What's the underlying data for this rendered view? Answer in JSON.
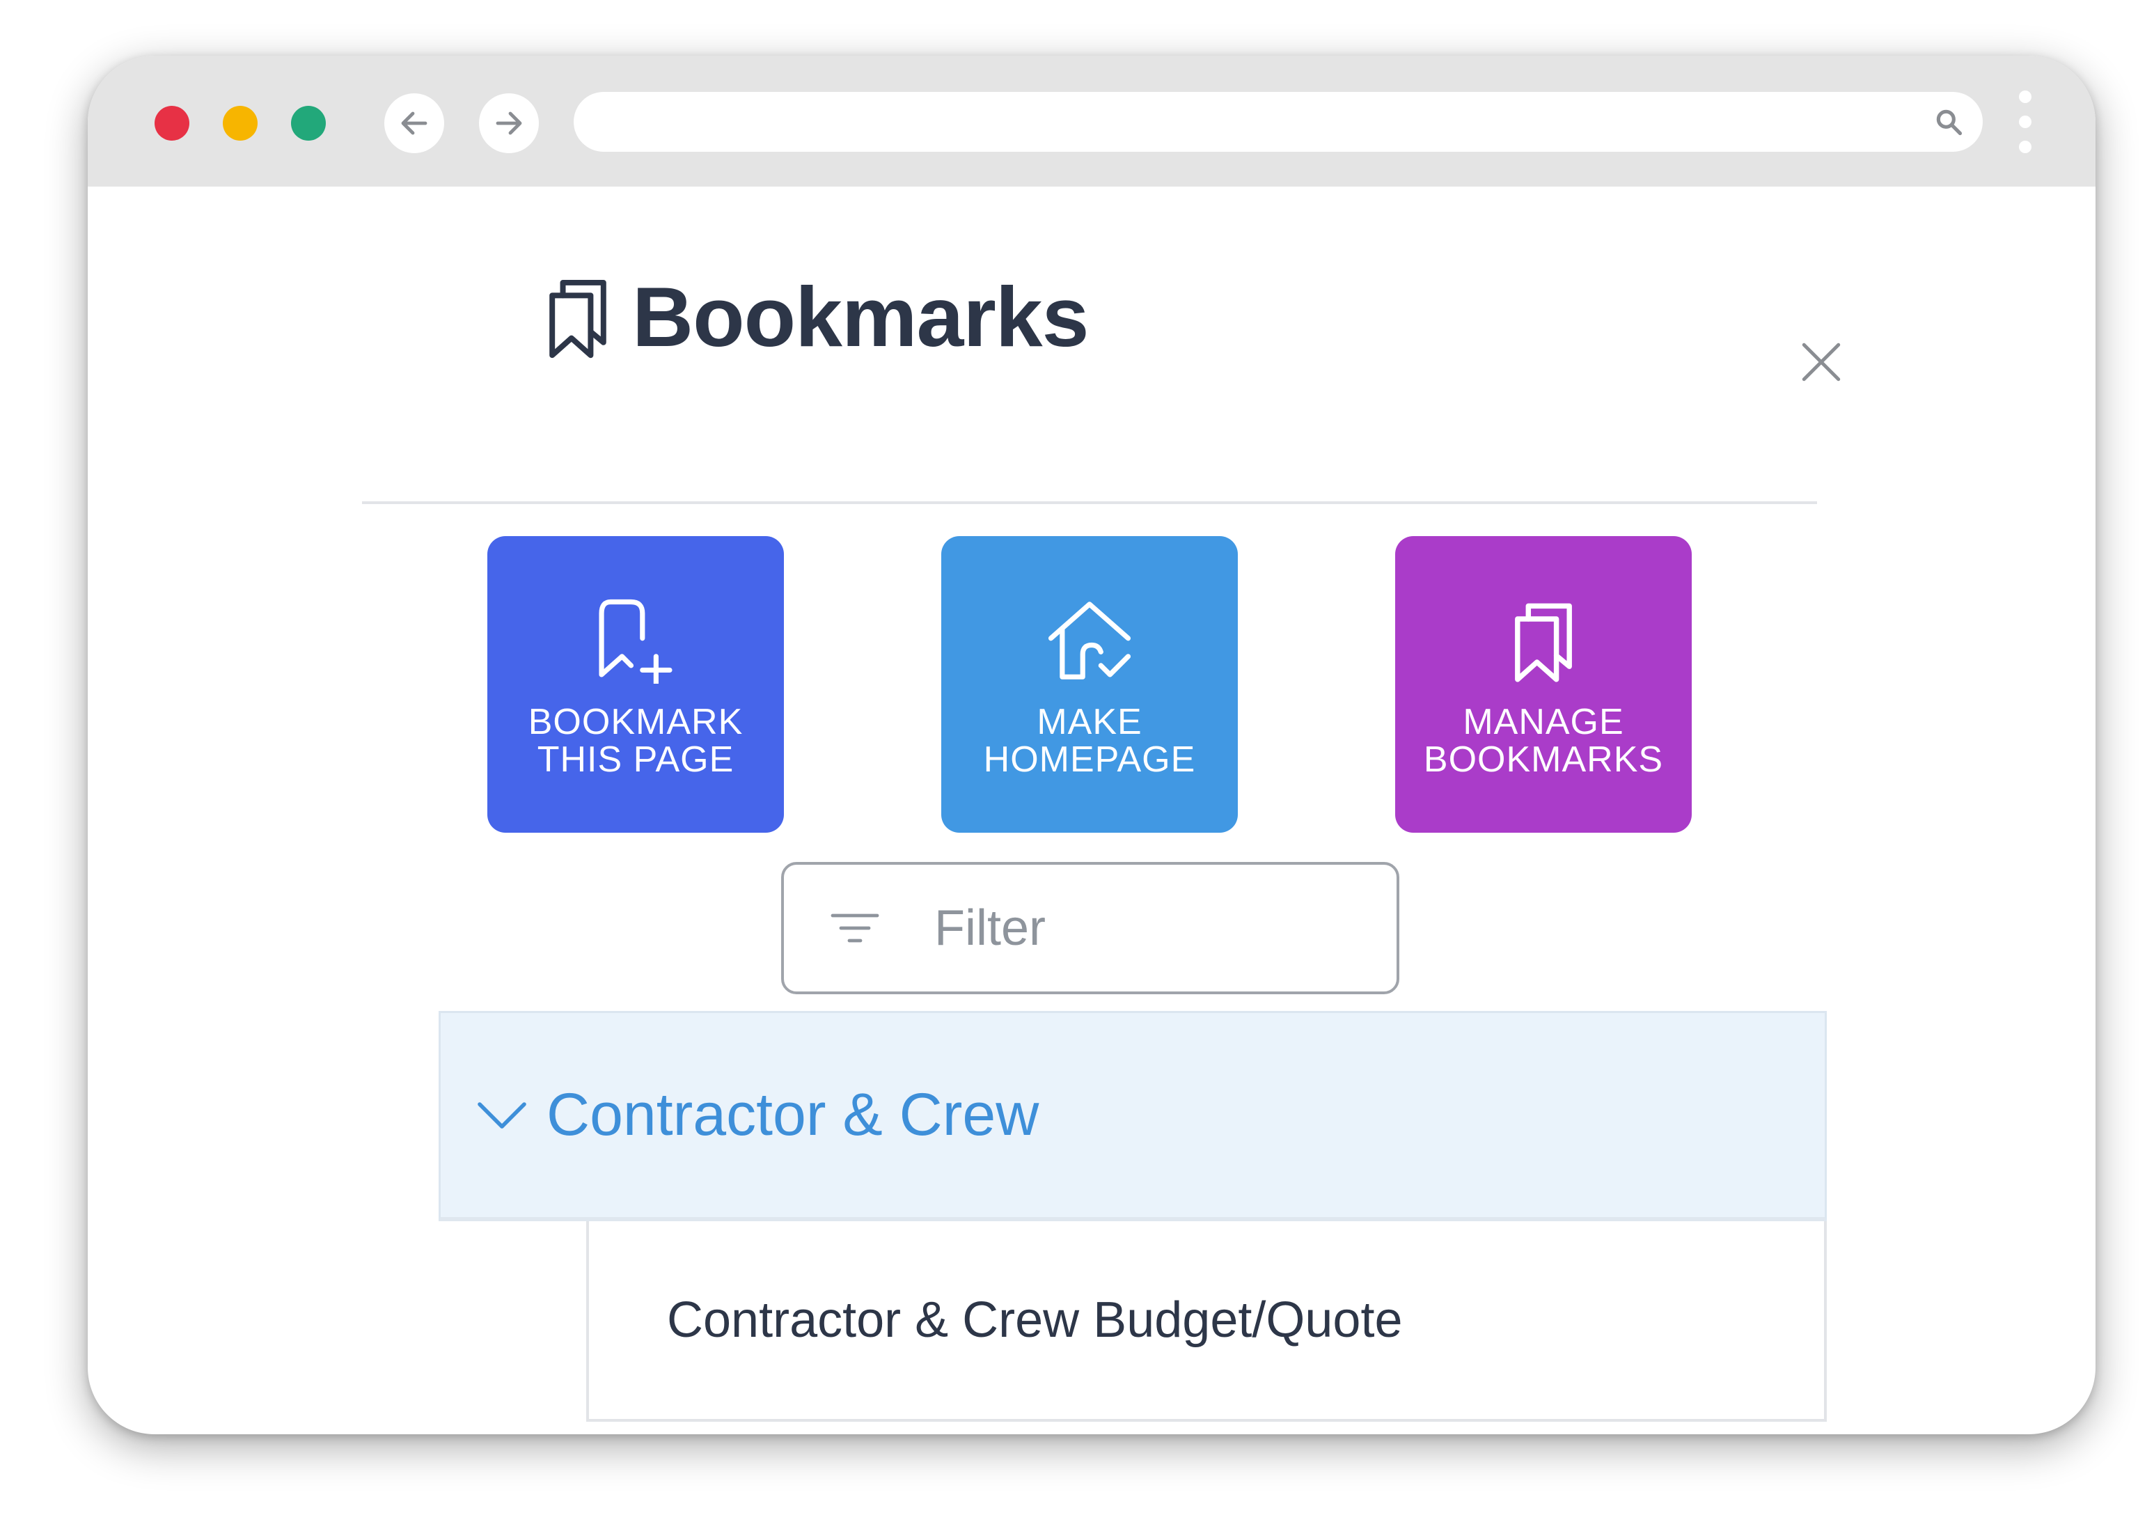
{
  "browser": {
    "icons": {
      "back": "arrow-left-icon",
      "forward": "arrow-right-icon",
      "search": "search-icon",
      "menu": "more-vertical-icon"
    },
    "colors": {
      "close": "#e73145",
      "minimize": "#f7b500",
      "maximize": "#22a87a"
    }
  },
  "panel": {
    "title": "Bookmarks",
    "title_icon": "bookmarks-icon",
    "close_icon": "close-icon",
    "actions": [
      {
        "label": "Bookmark this page",
        "icon": "bookmark-add-icon",
        "color": "#4665ea"
      },
      {
        "label": "Make homepage",
        "icon": "home-check-icon",
        "color": "#4198e3"
      },
      {
        "label": "Manage bookmarks",
        "icon": "bookmarks-icon",
        "color": "#aa3cc9"
      }
    ],
    "filter": {
      "placeholder": "Filter",
      "value": "",
      "icon": "filter-icon"
    },
    "groups": [
      {
        "name": "Contractor & Crew",
        "expanded": true,
        "icon": "chevron-down-icon",
        "items": [
          {
            "label": "Contractor & Crew Budget/Quote"
          }
        ]
      }
    ]
  }
}
